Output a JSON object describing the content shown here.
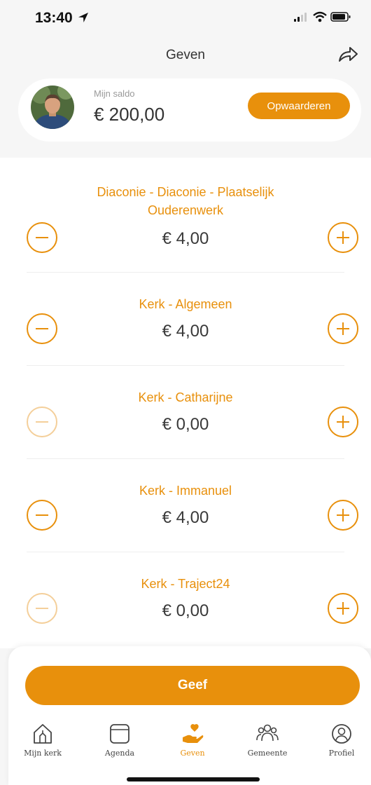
{
  "status_bar": {
    "time": "13:40"
  },
  "header": {
    "title": "Geven"
  },
  "balance": {
    "label": "Mijn saldo",
    "value": "€ 200,00",
    "topup_label": "Opwaarderen"
  },
  "funds": [
    {
      "name_line1": "Diaconie - Diaconie - Plaatselijk",
      "name_line2": "Ouderenwerk",
      "amount": "€ 4,00",
      "minus_enabled": true
    },
    {
      "name_line1": "Kerk - Algemeen",
      "amount": "€ 4,00",
      "minus_enabled": true
    },
    {
      "name_line1": "Kerk - Catharijne",
      "amount": "€ 0,00",
      "minus_enabled": false
    },
    {
      "name_line1": "Kerk - Immanuel",
      "amount": "€ 4,00",
      "minus_enabled": true
    },
    {
      "name_line1": "Kerk - Traject24",
      "amount": "€ 0,00",
      "minus_enabled": false
    }
  ],
  "give_button": {
    "label": "Geef"
  },
  "tabs": [
    {
      "label": "Mijn kerk",
      "icon": "home-icon"
    },
    {
      "label": "Agenda",
      "icon": "calendar-icon"
    },
    {
      "label": "Geven",
      "icon": "give-heart-icon",
      "active": true
    },
    {
      "label": "Gemeente",
      "icon": "people-icon"
    },
    {
      "label": "Profiel",
      "icon": "profile-icon"
    }
  ],
  "colors": {
    "accent": "#e8900c",
    "accent_disabled": "#f4cf9a",
    "background": "#f6f6f6"
  }
}
